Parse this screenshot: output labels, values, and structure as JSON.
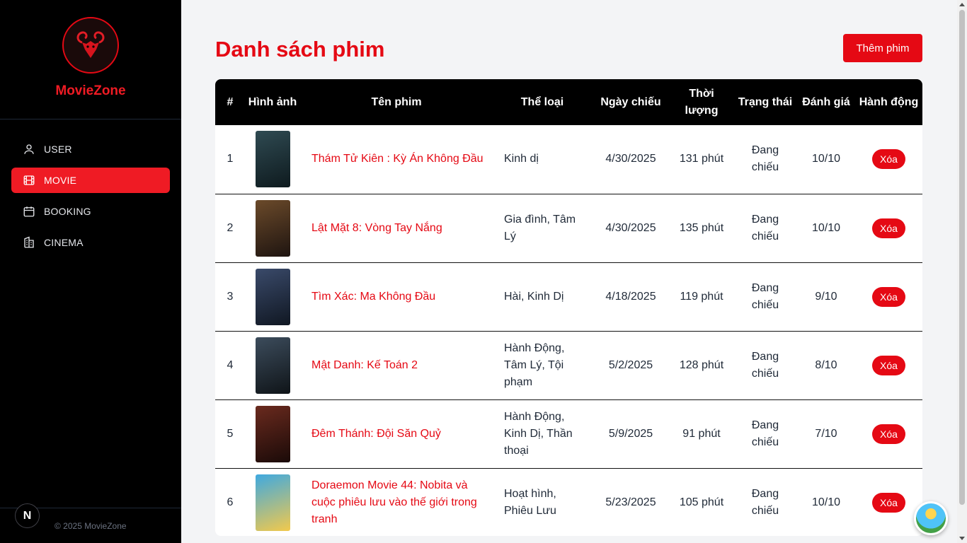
{
  "brand": {
    "name": "MovieZone"
  },
  "nav": [
    {
      "label": "USER",
      "icon": "user-icon",
      "active": false
    },
    {
      "label": "MOVIE",
      "icon": "film-icon",
      "active": true
    },
    {
      "label": "BOOKING",
      "icon": "calendar-icon",
      "active": false
    },
    {
      "label": "CINEMA",
      "icon": "building-icon",
      "active": false
    }
  ],
  "footer": {
    "text": "© 2025 MovieZone",
    "badge": "N"
  },
  "page": {
    "title": "Danh sách phim",
    "add_button": "Thêm phim"
  },
  "table": {
    "headers": [
      "#",
      "Hình ảnh",
      "Tên phim",
      "Thể loại",
      "Ngày chiếu",
      "Thời lượng",
      "Trạng thái",
      "Đánh giá",
      "Hành động"
    ],
    "rows": [
      {
        "index": "1",
        "name": "Thám Tử Kiên : Kỳ Án Không Đầu",
        "genre": "Kinh dị",
        "date": "4/30/2025",
        "duration": "131 phút",
        "status": "Đang chiếu",
        "rating": "10/10",
        "action": "Xóa",
        "poster_colors": [
          "#2f4a52",
          "#0e1a1e"
        ]
      },
      {
        "index": "2",
        "name": "Lật Mặt 8: Vòng Tay Nắng",
        "genre": "Gia đình, Tâm Lý",
        "date": "4/30/2025",
        "duration": "135 phút",
        "status": "Đang chiếu",
        "rating": "10/10",
        "action": "Xóa",
        "poster_colors": [
          "#6b4a2a",
          "#1e1410"
        ]
      },
      {
        "index": "3",
        "name": "Tìm Xác: Ma Không Đầu",
        "genre": "Hài, Kinh Dị",
        "date": "4/18/2025",
        "duration": "119 phút",
        "status": "Đang chiếu",
        "rating": "9/10",
        "action": "Xóa",
        "poster_colors": [
          "#3a4a6a",
          "#101722"
        ]
      },
      {
        "index": "4",
        "name": "Mật Danh: Kế Toán 2",
        "genre": "Hành Động, Tâm Lý, Tội phạm",
        "date": "5/2/2025",
        "duration": "128 phút",
        "status": "Đang chiếu",
        "rating": "8/10",
        "action": "Xóa",
        "poster_colors": [
          "#3c4c5c",
          "#0f1418"
        ]
      },
      {
        "index": "5",
        "name": "Đêm Thánh: Đội Săn Quỷ",
        "genre": "Hành Động, Kinh Dị, Thần thoại",
        "date": "5/9/2025",
        "duration": "91 phút",
        "status": "Đang chiếu",
        "rating": "7/10",
        "action": "Xóa",
        "poster_colors": [
          "#6a2a1e",
          "#1a0a08"
        ]
      },
      {
        "index": "6",
        "name": "Doraemon Movie 44: Nobita và cuộc phiêu lưu vào thế giới trong tranh",
        "genre": "Hoạt hình, Phiêu Lưu",
        "date": "5/23/2025",
        "duration": "105 phút",
        "status": "Đang chiếu",
        "rating": "10/10",
        "action": "Xóa",
        "poster_colors": [
          "#3fa9e0",
          "#f2c94c"
        ]
      }
    ]
  },
  "colors": {
    "accent": "#e50914",
    "sidebar_bg": "#000000",
    "page_bg": "#f3f4f6"
  }
}
